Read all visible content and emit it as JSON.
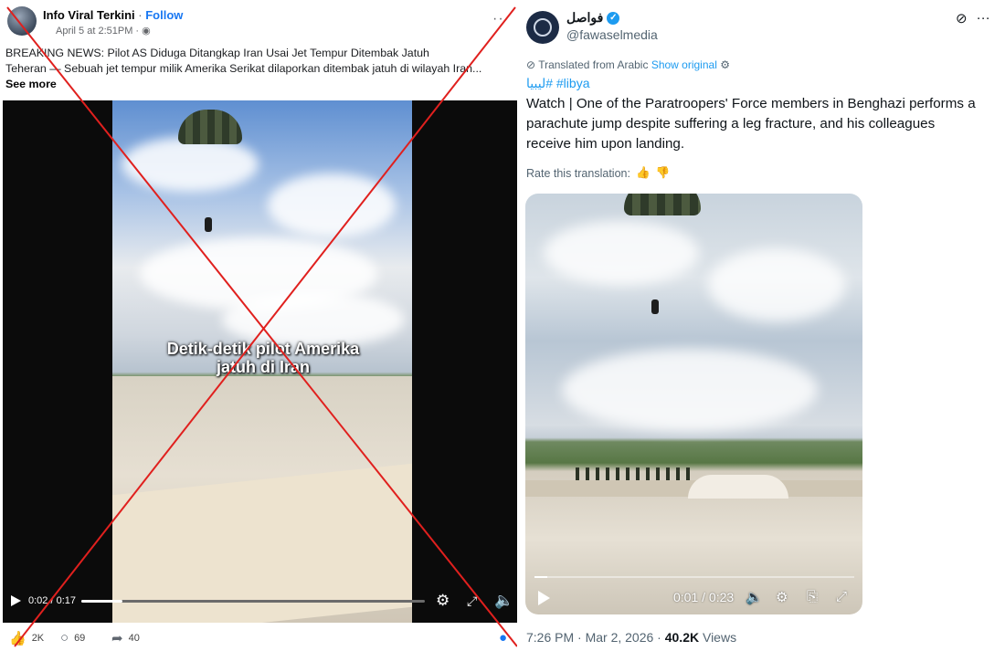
{
  "facebook": {
    "page_name": "Info Viral Terkini",
    "separator": " · ",
    "follow_label": "Follow",
    "meta": "April 5 at 2:51PM · ",
    "globe_icon": "globe-icon",
    "headline": "BREAKING NEWS: Pilot AS Diduga Ditangkap Iran Usai Jet Tempur Ditembak Jatuh",
    "body_line": "Teheran — Sebuah jet tempur milik Amerika Serikat dilaporkan ditembak jatuh di wilayah Iran...",
    "see_more": "See more",
    "video_caption_line1": "Detik-detik pilot Amerika",
    "video_caption_line2": "jatuh di Iran",
    "video_time": "0:02 / 0:17",
    "video_progress": 0.12,
    "likes": "2K",
    "comments": "69",
    "shares": "40",
    "x_mark_color": "#e0201e"
  },
  "twitter": {
    "display_name": "فواصل",
    "handle": "@fawaselmedia",
    "translated_from": "Translated from Arabic",
    "show_original": "Show original",
    "hashtags": "ليبيا# #libya",
    "body_lines": [
      "Watch | One of the Paratroopers' Force members in Benghazi performs a",
      "parachute jump despite suffering a leg fracture, and his colleagues",
      "receive him upon landing."
    ],
    "rate_label": "Rate this translation:",
    "video_time": "0:01 / 0:23",
    "video_progress": 0.04,
    "timestamp": "7:26 PM · Mar 2, 2026 · ",
    "views_count": "40.2K",
    "views_label": " Views",
    "accent_color": "#1d9bf0"
  }
}
